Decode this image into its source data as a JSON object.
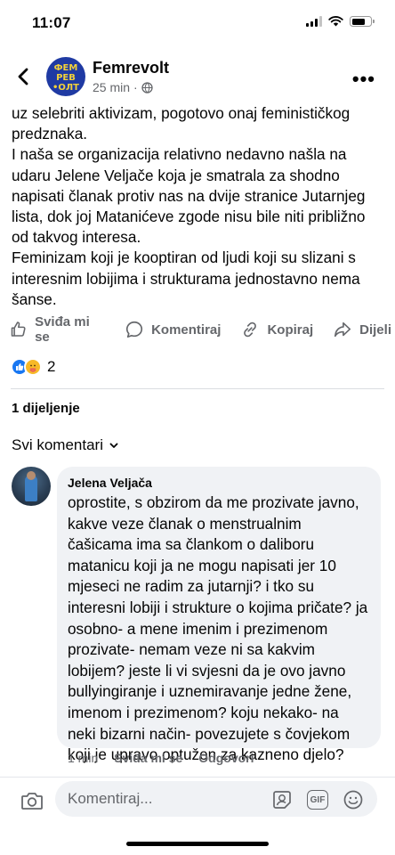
{
  "status_bar": {
    "time": "11:07"
  },
  "header": {
    "page_name": "Femrevolt",
    "time_ago": "25 min",
    "separator": "·",
    "logo_lines": [
      "ФЕМ",
      "РЕВ",
      "•ОЛТ"
    ]
  },
  "post": {
    "paragraphs": [
      "uz selebriti aktivizam, pogotovo onaj feminističkog predznaka.",
      "I naša se organizacija relativno nedavno našla na udaru Jelene Veljače koja je smatrala za shodno napisati članak protiv nas na dvije stranice Jutarnjeg lista, dok joj Matanićeve zgode nisu bile niti približno od takvog interesa.",
      "Feminizam koji je kooptiran od ljudi koji su slizani s interesnim lobijima i strukturama jednostavno nema šanse."
    ]
  },
  "actions": {
    "like": "Sviđa mi se",
    "comment": "Komentiraj",
    "copy": "Kopiraj",
    "share": "Dijeli"
  },
  "reactions": {
    "count": "2"
  },
  "shares_label": "1 dijeljenje",
  "comments_filter": "Svi komentari",
  "comment": {
    "author": "Jelena Veljača",
    "text": "oprostite, s obzirom da me prozivate javno, kakve veze članak o menstrualnim čašicama ima sa člankom o daliboru matanicu koji ja ne mogu napisati jer 10 mjeseci ne radim za jutarnji? i tko su interesni lobiji i strukture o kojima pričate? ja osobno- a mene imenim i prezimenom prozivate- nemam veze ni sa kakvim lobijem? jeste li vi svjesni da je ovo javno bullyingiranje i uznemiravanje jedne žene, imenom i prezimenom? koju nekako- na neki bizarni način- povezujete s čovjekom koji je upravo optužen za kazneno djelo?",
    "time": "1 min",
    "like": "Sviđa mi se",
    "reply": "Odgovori"
  },
  "composer": {
    "placeholder": "Komentiraj...",
    "gif_label": "GIF"
  },
  "colors": {
    "brand_blue": "#1f3aa3",
    "logo_yellow": "#f2d13a",
    "like_blue": "#1877f2",
    "care_yellow": "#f7b928",
    "secondary_text": "#65676b",
    "bubble_bg": "#f0f2f5"
  }
}
